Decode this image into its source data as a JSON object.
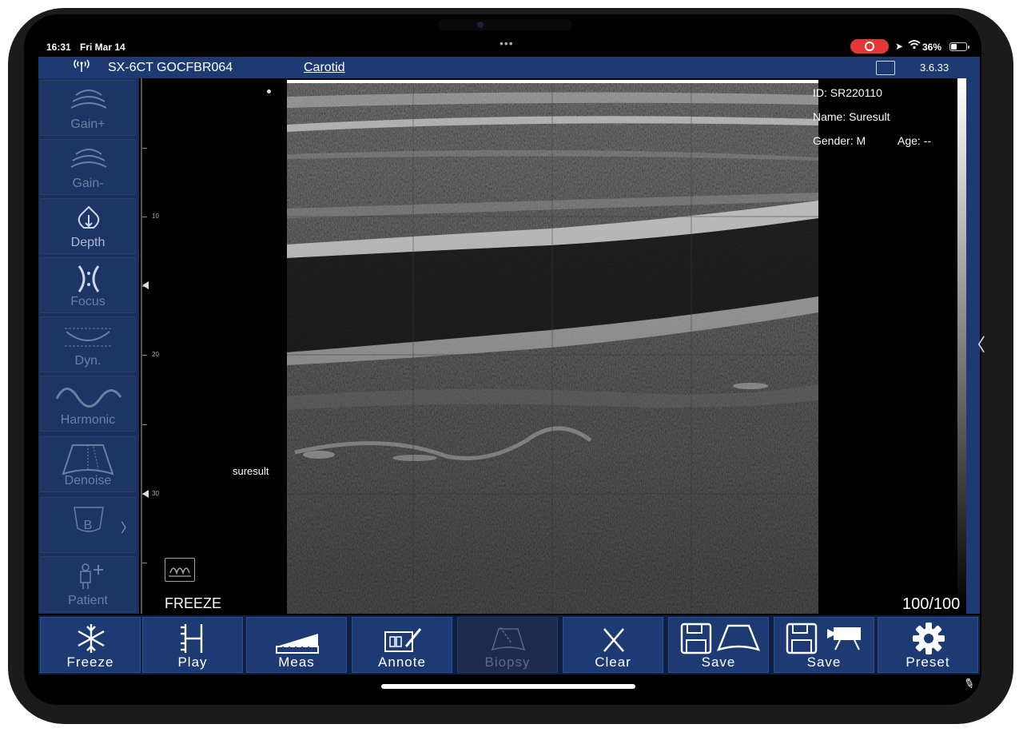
{
  "status_bar": {
    "time": "16:31",
    "date": "Fri Mar 14",
    "battery_percent": "36%"
  },
  "top_bar": {
    "device_id": "SX-6CT GOCFBR064",
    "preset": "Carotid",
    "version": "3.6.33"
  },
  "sidebar": {
    "items": [
      {
        "label": "Gain+",
        "icon": "gain-plus-icon"
      },
      {
        "label": "Gain-",
        "icon": "gain-minus-icon"
      },
      {
        "label": "Depth",
        "icon": "depth-icon"
      },
      {
        "label": "Focus",
        "icon": "focus-icon"
      },
      {
        "label": "Dyn.",
        "icon": "dynamic-range-icon"
      },
      {
        "label": "Harmonic",
        "icon": "harmonic-wave-icon"
      },
      {
        "label": "Denoise",
        "icon": "denoise-icon"
      },
      {
        "label": "B",
        "icon": "b-mode-icon"
      },
      {
        "label": "Patient",
        "icon": "patient-icon"
      }
    ]
  },
  "depth_scale": {
    "labels": [
      "10",
      "20",
      "30"
    ]
  },
  "image_panel": {
    "watermark": "suresult",
    "freeze_state": "FREEZE",
    "frame_counter": "100/100"
  },
  "patient_info": {
    "id": "ID: SR220110",
    "name": "Name: Suresult",
    "gender": "Gender: M",
    "age": "Age: --"
  },
  "bottom_bar": {
    "buttons": [
      {
        "label": "Freeze",
        "icon": "snowflake-icon",
        "enabled": true
      },
      {
        "label": "Play",
        "icon": "play-cine-icon",
        "enabled": true
      },
      {
        "label": "Meas",
        "icon": "ruler-icon",
        "enabled": true
      },
      {
        "label": "Annote",
        "icon": "annotate-icon",
        "enabled": true
      },
      {
        "label": "Biopsy",
        "icon": "biopsy-icon",
        "enabled": false
      },
      {
        "label": "Clear",
        "icon": "clear-x-icon",
        "enabled": true
      },
      {
        "label": "Save",
        "icon": "save-image-icon",
        "enabled": true
      },
      {
        "label": "Save",
        "icon": "save-video-icon",
        "enabled": true
      },
      {
        "label": "Preset",
        "icon": "gear-icon",
        "enabled": true
      }
    ]
  },
  "colors": {
    "header_blue": "#1d3a73",
    "sidebar_blue": "#1a2f5c",
    "record_red": "#e5373a"
  }
}
